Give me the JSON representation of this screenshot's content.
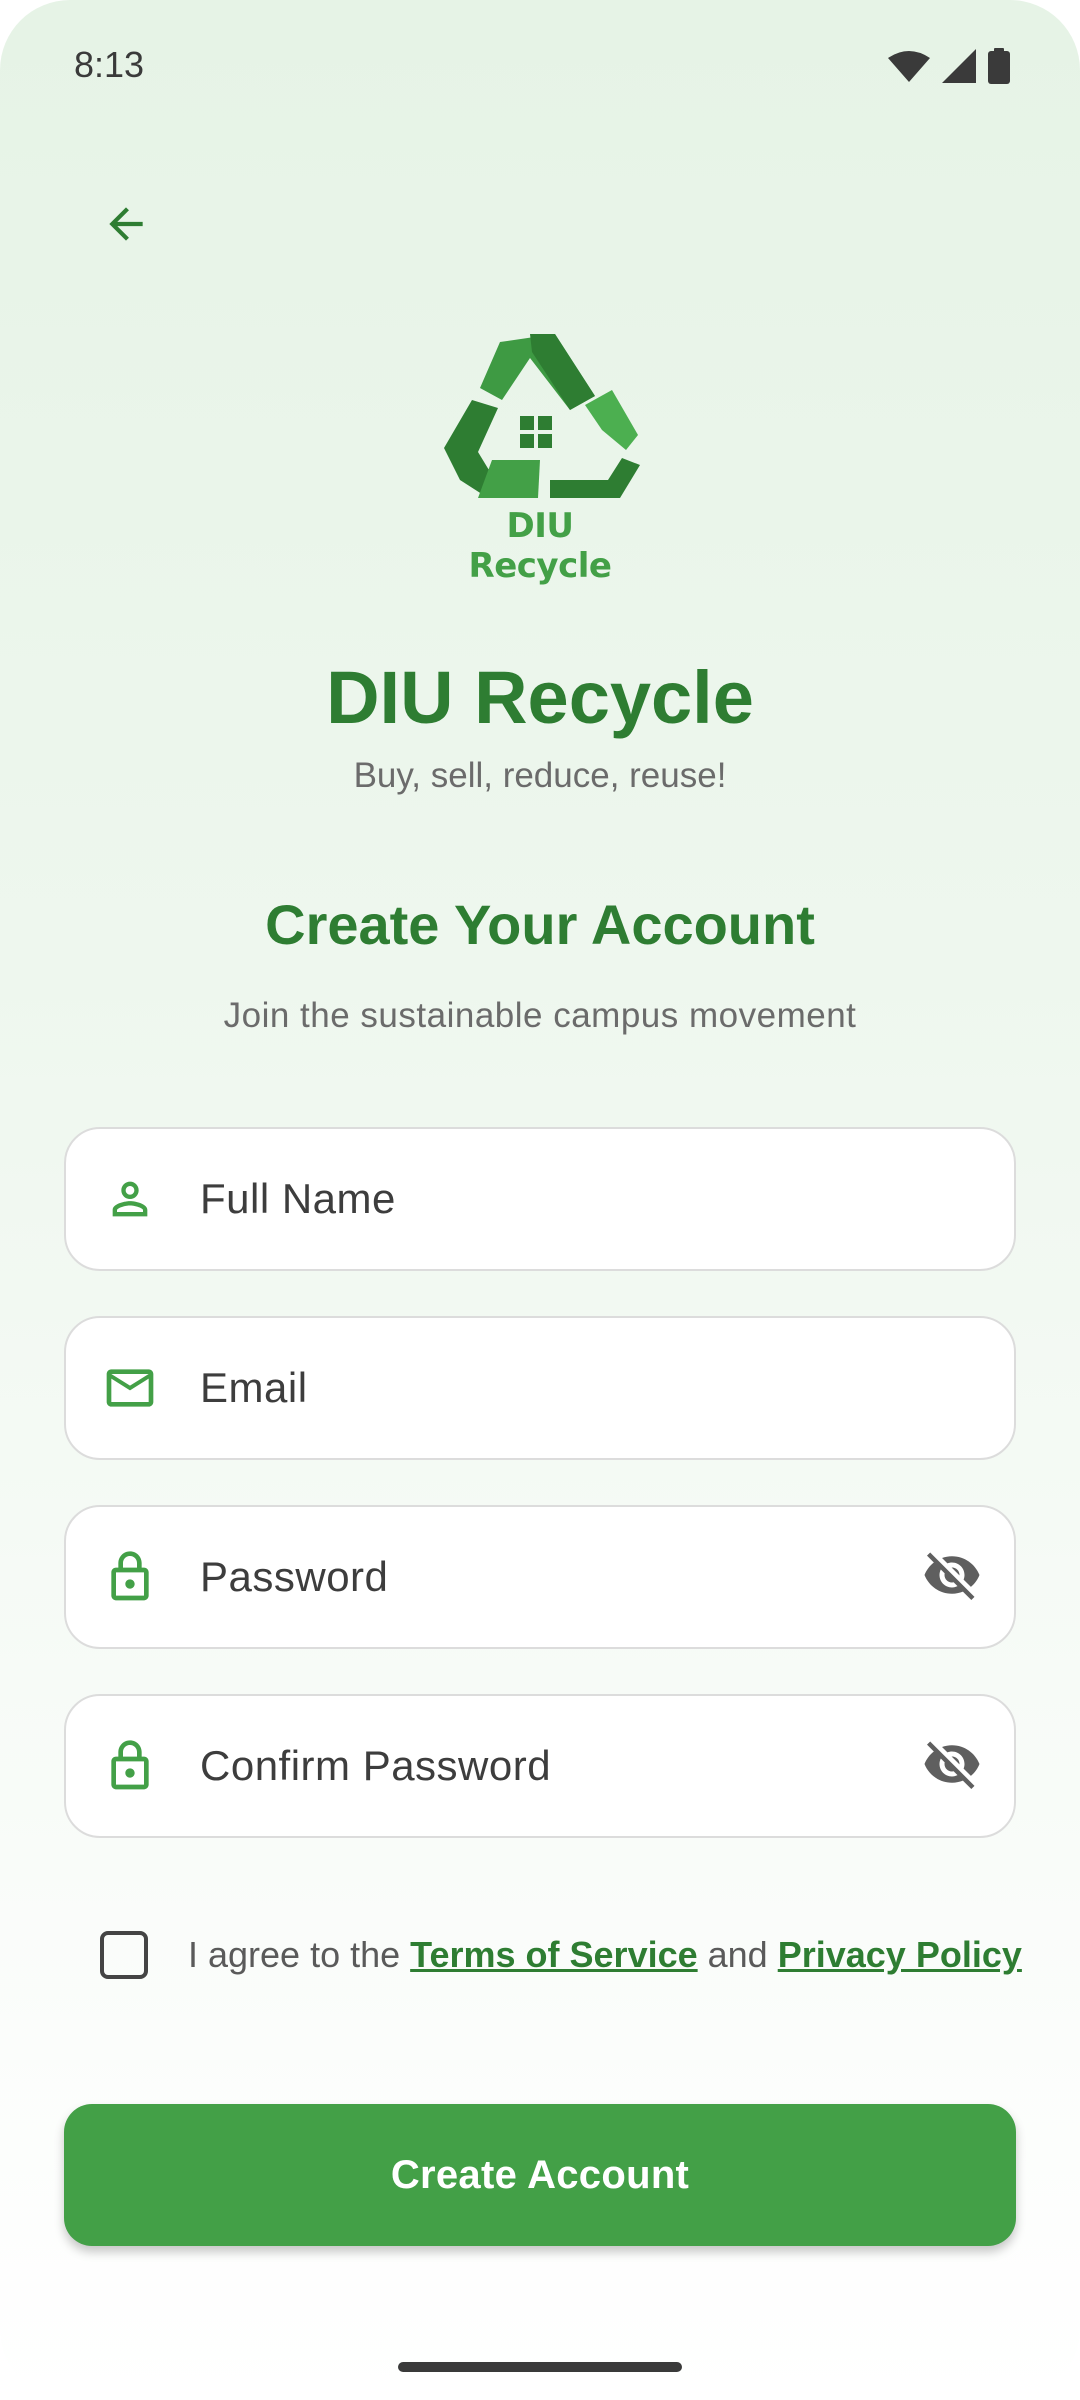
{
  "status_bar": {
    "time": "8:13"
  },
  "logo": {
    "wordmark": "DIU Recycle"
  },
  "app": {
    "title": "DIU Recycle",
    "tagline": "Buy, sell, reduce, reuse!"
  },
  "section": {
    "title": "Create Your Account",
    "subtitle": "Join the sustainable campus movement"
  },
  "form": {
    "full_name": {
      "placeholder": "Full Name",
      "value": ""
    },
    "email": {
      "placeholder": "Email",
      "value": ""
    },
    "password": {
      "placeholder": "Password",
      "value": ""
    },
    "confirm_password": {
      "placeholder": "Confirm Password",
      "value": ""
    }
  },
  "agreement": {
    "prefix": "I agree to the ",
    "terms": "Terms of Service",
    "middle": " and ",
    "privacy": "Privacy Policy",
    "checked": false
  },
  "submit_label": "Create Account",
  "icons": {
    "back": "arrow-back-icon",
    "person": "person-icon",
    "mail": "mail-icon",
    "lock": "lock-icon",
    "visibility_off": "visibility-off-icon"
  },
  "colors": {
    "primary": "#43a047",
    "primary_dark": "#2e7d32",
    "text_muted": "#6b6b6b"
  }
}
